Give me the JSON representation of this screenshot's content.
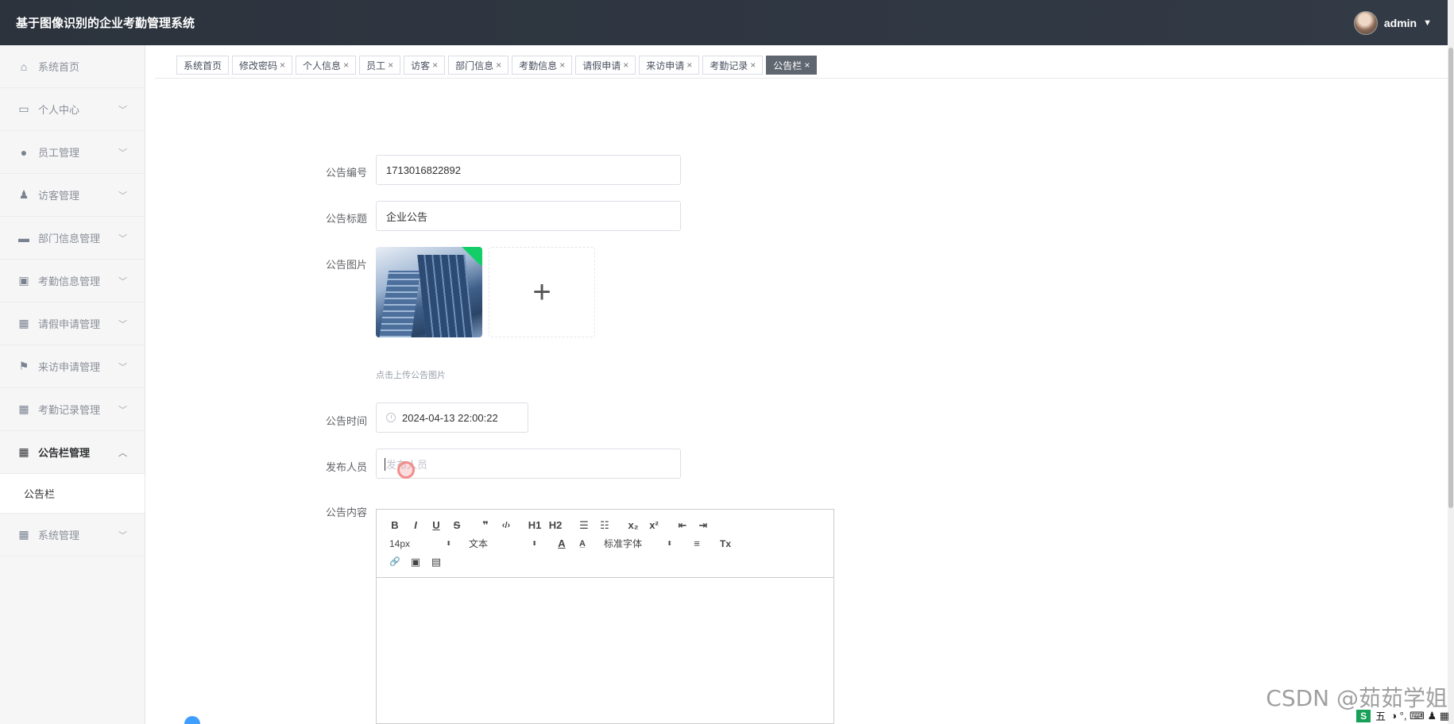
{
  "header": {
    "title": "基于图像识别的企业考勤管理系统",
    "username": "admin",
    "caret": "▼"
  },
  "sidebar": {
    "items": [
      {
        "label": "系统首页",
        "icon": "home-icon",
        "glyph": "⌂",
        "chevron": ""
      },
      {
        "label": "个人中心",
        "icon": "card-icon",
        "glyph": "▭",
        "chevron": "﹀"
      },
      {
        "label": "员工管理",
        "icon": "location-icon",
        "glyph": "●",
        "chevron": "﹀"
      },
      {
        "label": "访客管理",
        "icon": "user-icon",
        "glyph": "♟",
        "chevron": "﹀"
      },
      {
        "label": "部门信息管理",
        "icon": "monitor-icon",
        "glyph": "▬",
        "chevron": "﹀"
      },
      {
        "label": "考勤信息管理",
        "icon": "clipboard-icon",
        "glyph": "▣",
        "chevron": "﹀"
      },
      {
        "label": "请假申请管理",
        "icon": "grid-icon",
        "glyph": "▦",
        "chevron": "﹀"
      },
      {
        "label": "来访申请管理",
        "icon": "flag-icon",
        "glyph": "⚑",
        "chevron": "﹀"
      },
      {
        "label": "考勤记录管理",
        "icon": "grid-icon",
        "glyph": "▦",
        "chevron": "﹀"
      },
      {
        "label": "公告栏管理",
        "icon": "apps-icon",
        "glyph": "▦",
        "chevron": "︿"
      }
    ],
    "sub_item": "公告栏",
    "last_item": {
      "label": "系统管理",
      "icon": "grid-icon",
      "glyph": "▦",
      "chevron": "﹀"
    }
  },
  "tabs": [
    {
      "label": "系统首页",
      "close": ""
    },
    {
      "label": "修改密码",
      "close": "×"
    },
    {
      "label": "个人信息",
      "close": "×"
    },
    {
      "label": "员工",
      "close": "×"
    },
    {
      "label": "访客",
      "close": "×"
    },
    {
      "label": "部门信息",
      "close": "×"
    },
    {
      "label": "考勤信息",
      "close": "×"
    },
    {
      "label": "请假申请",
      "close": "×"
    },
    {
      "label": "来访申请",
      "close": "×"
    },
    {
      "label": "考勤记录",
      "close": "×"
    },
    {
      "label": "公告栏",
      "close": "×",
      "active": true
    }
  ],
  "form": {
    "number_label": "公告编号",
    "number_value": "1713016822892",
    "title_label": "公告标题",
    "title_value": "企业公告",
    "image_label": "公告图片",
    "upload_plus": "+",
    "upload_tip": "点击上传公告图片",
    "time_label": "公告时间",
    "time_value": "2024-04-13 22:00:22",
    "publisher_label": "发布人员",
    "publisher_placeholder": "发布人员",
    "content_label": "公告内容"
  },
  "editor": {
    "row1": [
      "B",
      "I",
      "U",
      "S",
      "❞",
      "‹/›",
      "H1",
      "H2",
      "☰",
      "☷",
      "x₂",
      "x²",
      "⇤",
      "⇥"
    ],
    "font_size": "14px",
    "header_select": "文本",
    "font_family": "标准字体",
    "select_arrow": "⬍",
    "row2_tools": [
      "A",
      "A̲",
      "≡",
      "Tx"
    ],
    "row3": [
      "🔗",
      "▣",
      "▤"
    ]
  },
  "watermark": "CSDN @茹茹学姐",
  "tray": {
    "logo": "S",
    "ime": "五",
    "icons": "◑ °, ⌨ ♟ ▦"
  }
}
